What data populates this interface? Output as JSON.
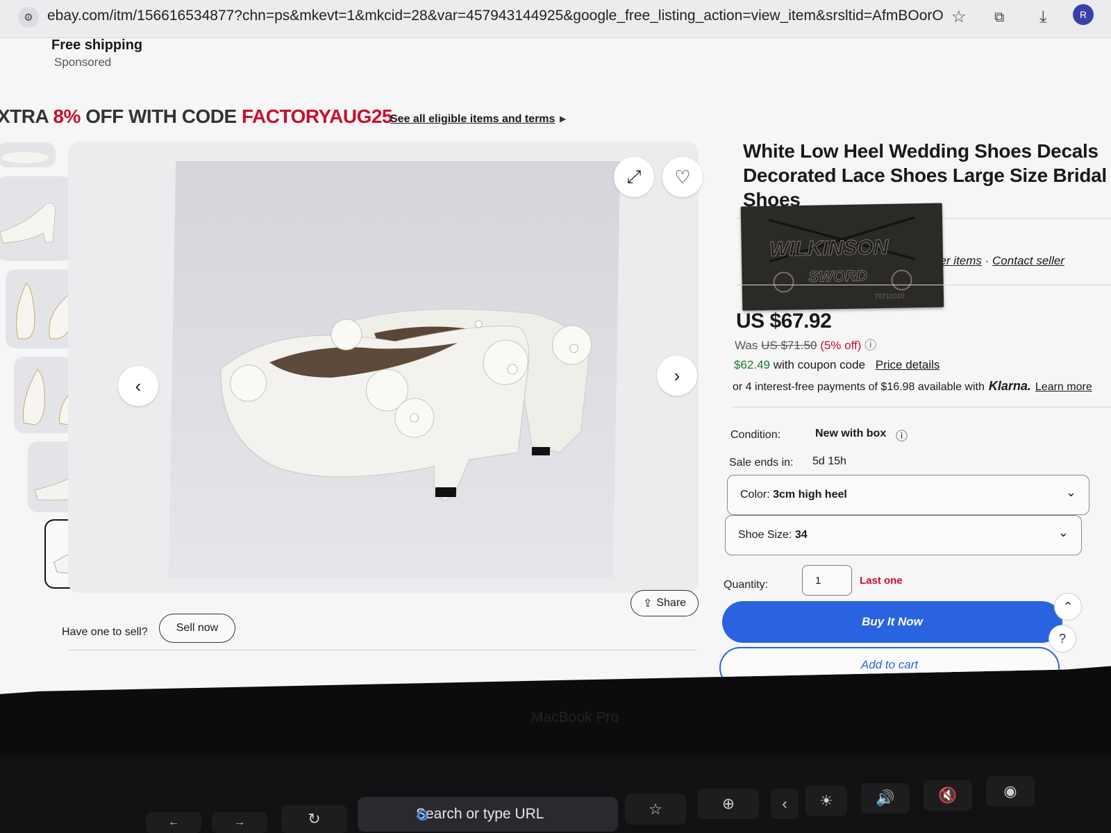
{
  "browser": {
    "url": "ebay.com/itm/156616534877?chn=ps&mkevt=1&mkcid=28&var=457943144925&google_free_listing_action=view_item&srsltid=AfmBOorOBncr...",
    "profile_initial": "R"
  },
  "top_listing": {
    "shipping": "Free shipping",
    "sponsored": "Sponsored"
  },
  "promo": {
    "part1": "XTRA ",
    "percent": "8%",
    "part2": " OFF WITH CODE ",
    "code": "FACTORYAUG25",
    "link": "See all eligible items and terms"
  },
  "gallery": {
    "thumbnail_count": 6,
    "selected_index": 5,
    "share_label": "Share"
  },
  "sell": {
    "question": "Have one to sell?",
    "button": "Sell now"
  },
  "product": {
    "title": "White Low Heel Wedding Shoes Decals Decorated Lace Shoes Large Size Bridal Shoes",
    "seller_links": {
      "other_items": "her items",
      "separator": " · ",
      "contact": "Contact seller"
    },
    "overlay_sticker": {
      "brand_line1": "WILKINSON",
      "brand_line2": "SWORD",
      "code": "70711010"
    },
    "price": "US $67.92",
    "was_label": "Was",
    "was_price": "US $71.50",
    "discount": "(5% off)",
    "coupon_price": "$62.49",
    "coupon_text": " with coupon code",
    "price_details": "Price details",
    "klarna_text": "or 4 interest-free payments of $16.98 available with",
    "klarna_brand": "Klarna.",
    "learn_more": "Learn more",
    "condition_label": "Condition:",
    "condition_value": "New with box",
    "sale_label": "Sale ends in:",
    "sale_value": "5d 15h",
    "color_label": "Color: ",
    "color_value": "3cm high heel",
    "size_label": "Shoe Size: ",
    "size_value": "34",
    "quantity_label": "Quantity:",
    "quantity_value": "1",
    "stock_note": "Last one",
    "buy_now": "Buy It Now",
    "add_to_cart": "Add to cart"
  },
  "laptop": {
    "model_label": "MacBook Pro",
    "search_placeholder": "Search or type URL"
  },
  "colors": {
    "ebay_red": "#c8102e",
    "ebay_blue": "#2a63e0",
    "coupon_green": "#1b7a2f"
  }
}
